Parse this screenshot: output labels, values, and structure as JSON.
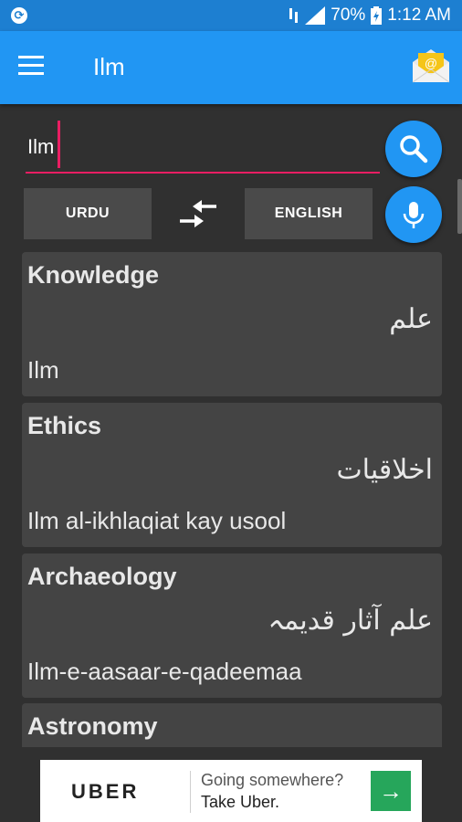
{
  "status_bar": {
    "battery": "70%",
    "time": "1:12 AM"
  },
  "app_bar": {
    "title": "Ilm"
  },
  "search": {
    "query": "Ilm"
  },
  "language": {
    "from": "URDU",
    "to": "ENGLISH"
  },
  "results": [
    {
      "word": "Knowledge",
      "urdu": "علم",
      "roman": "Ilm"
    },
    {
      "word": "Ethics",
      "urdu": "اخلاقیات",
      "roman": "Ilm al-ikhlaqiat kay usool"
    },
    {
      "word": "Archaeology",
      "urdu": "علم آثار قدیمہ",
      "roman": "Ilm-e-aasaar-e-qadeemaa"
    },
    {
      "word": "Astronomy",
      "urdu": "",
      "roman": ""
    }
  ],
  "ad": {
    "brand": "UBER",
    "line1": "Going somewhere?",
    "line2": "Take Uber."
  },
  "colors": {
    "app_bar": "#2196f3",
    "status_bar": "#1d7fd1",
    "accent": "#e91e63",
    "background": "#303030",
    "card": "#444444"
  }
}
